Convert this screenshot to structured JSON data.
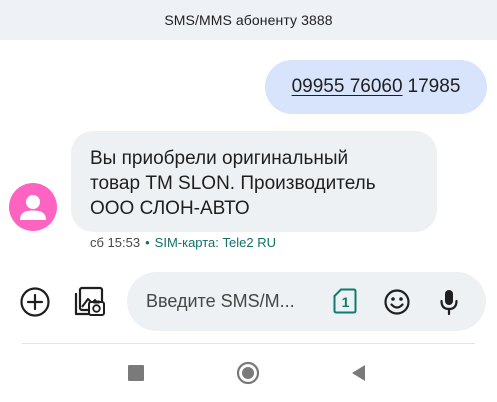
{
  "header": {
    "title": "SMS/MMS абоненту 3888"
  },
  "messages": {
    "outgoing": {
      "number_link": "09955 76060",
      "number_rest": "17985"
    },
    "incoming": {
      "lines": [
        "Вы приобрели оригинальный",
        "товар ТМ SLON. Производитель",
        "ООО СЛОН-АВТО"
      ],
      "time": "сб 15:53",
      "separator": "•",
      "sim": "SIM-карта: Tele2 RU",
      "avatar_color": "#ff63c1"
    }
  },
  "composer": {
    "placeholder": "Введите SMS/M...",
    "sim_slot": "1",
    "icons": [
      "add-circle-icon",
      "gallery-icon",
      "sim-card-icon",
      "emoji-icon",
      "mic-icon"
    ]
  },
  "navigation": {
    "icons": [
      "recents-square-icon",
      "home-circle-icon",
      "back-triangle-icon"
    ]
  },
  "colors": {
    "header_bg": "#eef1f6",
    "outgoing_bubble": "#d8e4fb",
    "incoming_bubble": "#eef1f4",
    "sim_text": "#126f6a",
    "sim_icon": "#0f7a6f"
  }
}
